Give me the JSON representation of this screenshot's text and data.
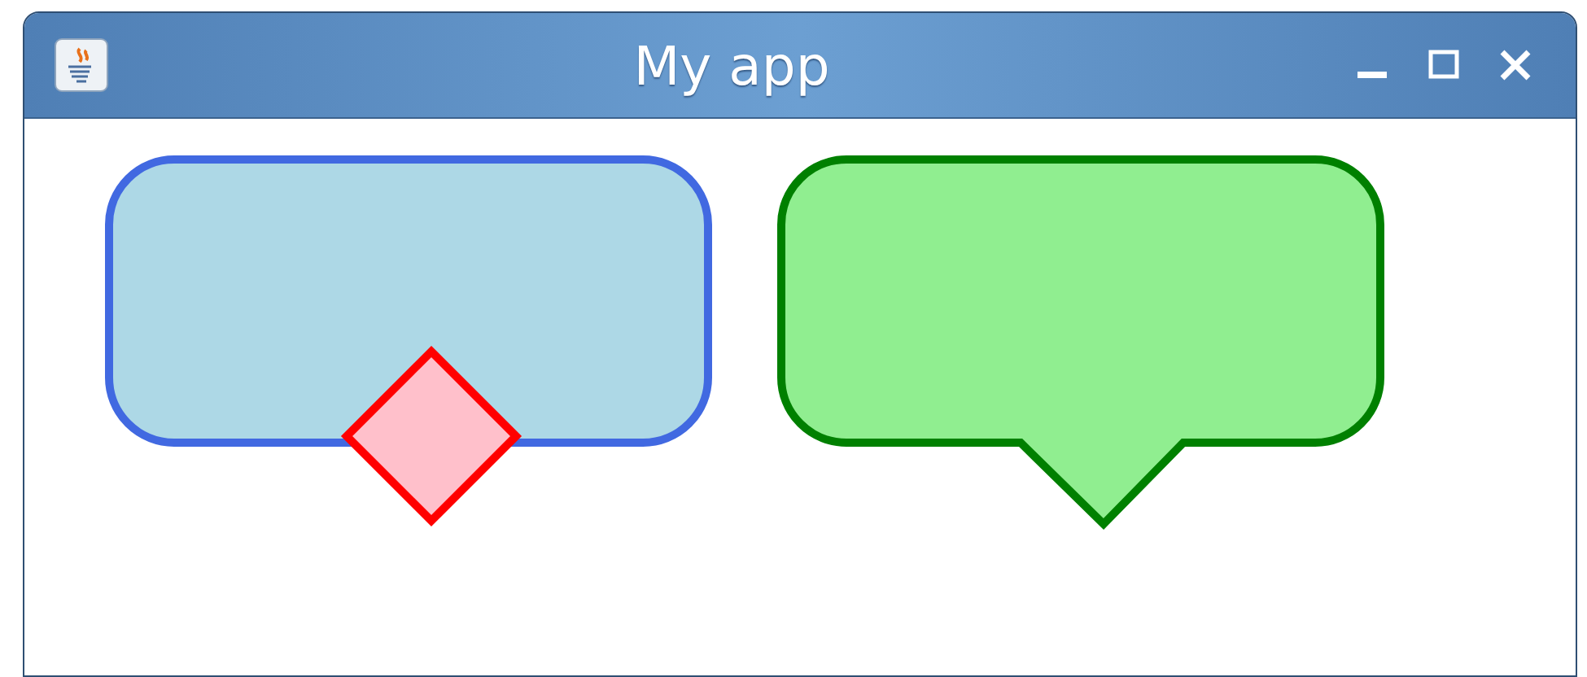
{
  "window": {
    "title": "My app"
  },
  "canvas": {
    "shapes": [
      {
        "kind": "rounded-rect",
        "color": "#4169e1"
      },
      {
        "kind": "diamond",
        "color": "#ff0000"
      },
      {
        "kind": "callout",
        "color": "#008000"
      }
    ]
  }
}
